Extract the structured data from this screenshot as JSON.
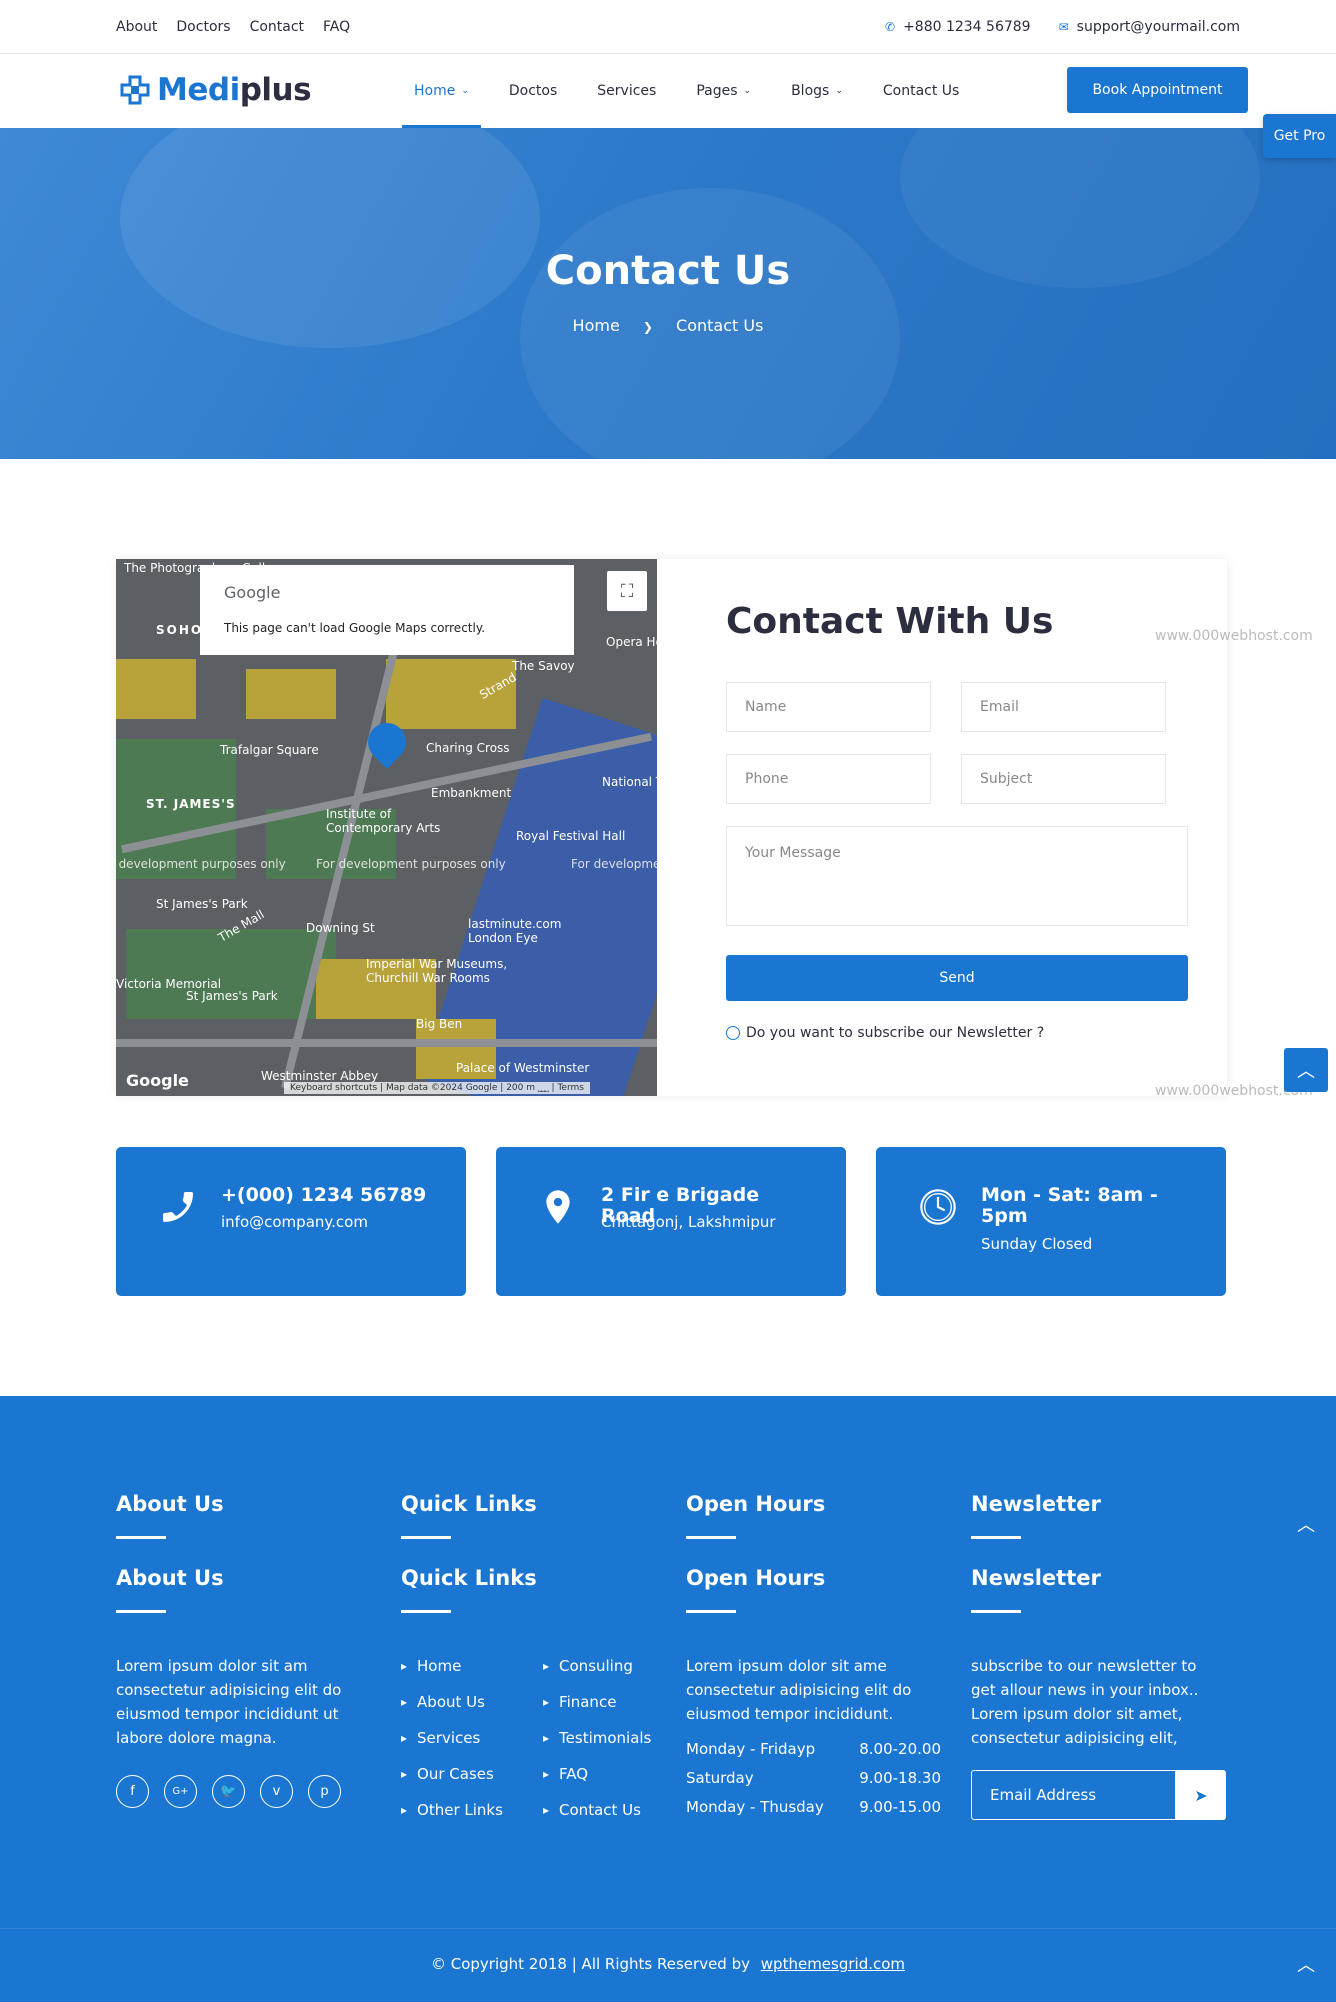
{
  "topbar": {
    "links": [
      "About",
      "Doctors",
      "Contact",
      "FAQ"
    ],
    "phone": "+880 1234 56789",
    "email": "support@yourmail.com"
  },
  "header": {
    "logo_blue": "Medi",
    "logo_dark": "plus",
    "nav": [
      {
        "label": "Home",
        "dropdown": true,
        "active": true
      },
      {
        "label": "Doctos",
        "dropdown": false
      },
      {
        "label": "Services",
        "dropdown": false
      },
      {
        "label": "Pages",
        "dropdown": true
      },
      {
        "label": "Blogs",
        "dropdown": true
      },
      {
        "label": "Contact Us",
        "dropdown": false
      }
    ],
    "book_button": "Book Appointment",
    "get_pro": "Get Pro"
  },
  "hero": {
    "title": "Contact Us",
    "crumb_home": "Home",
    "crumb_current": "Contact Us"
  },
  "map": {
    "provider": "Google",
    "error_message": "This page can't load Google Maps correctly.",
    "watermark": "For development purposes only",
    "labels": [
      "The Photographers Gallery",
      "SOHO",
      "Trafalgar Square",
      "Charing Cross",
      "ST. JAMES'S",
      "Institute of Contemporary Arts",
      "Embankment",
      "Royal Festival Hall",
      "St James's Park",
      "The Mall",
      "Downing St",
      "Imperial War Museums, Churchill War Rooms",
      "lastminute.com London Eye",
      "St James's Park",
      "Victoria Memorial",
      "Big Ben",
      "Westminster Abbey",
      "Palace of Westminster",
      "The Savoy",
      "Strand",
      "Opera House",
      "National Th"
    ],
    "attribution": [
      "Keyboard shortcuts",
      "Map data ©2024 Google",
      "200 m",
      "Terms"
    ]
  },
  "contact_form": {
    "title": "Contact With Us",
    "name_placeholder": "Name",
    "email_placeholder": "Email",
    "phone_placeholder": "Phone",
    "subject_placeholder": "Subject",
    "message_placeholder": "Your Message",
    "send_button": "Send",
    "newsletter_label": "Do you want to subscribe our Newsletter ?"
  },
  "broken_image_alt": "www.000webhost.com",
  "info_cards": [
    {
      "icon": "phone-icon",
      "title": "+(000) 1234 56789",
      "sub": "info@company.com"
    },
    {
      "icon": "map-pin-icon",
      "title": "2 Fir e Brigade Road",
      "sub": "Chittagonj, Lakshmipur"
    },
    {
      "icon": "clock-icon",
      "title": "Mon - Sat: 8am - 5pm",
      "sub": "Sunday Closed"
    }
  ],
  "footer": {
    "headings_row1": [
      "About Us",
      "Quick Links",
      "Open Hours",
      "Newsletter"
    ],
    "headings_row2": [
      "About Us",
      "Quick Links",
      "Open Hours",
      "Newsletter"
    ],
    "about_text": "Lorem ipsum dolor sit am consectetur adipisicing elit do eiusmod tempor incididunt ut labore dolore magna.",
    "social": [
      "f",
      "G+",
      "twitter",
      "v",
      "p"
    ],
    "quick_links_col1": [
      "Home",
      "About Us",
      "Services",
      "Our Cases",
      "Other Links"
    ],
    "quick_links_col2": [
      "Consuling",
      "Finance",
      "Testimonials",
      "FAQ",
      "Contact Us"
    ],
    "hours_text": "Lorem ipsum dolor sit ame consectetur adipisicing elit do eiusmod tempor incididunt.",
    "hours": [
      {
        "day": "Monday - Fridayp",
        "time": "8.00-20.00"
      },
      {
        "day": "Saturday",
        "time": "9.00-18.30"
      },
      {
        "day": "Monday - Thusday",
        "time": "9.00-15.00"
      }
    ],
    "newsletter_text": "subscribe to our newsletter to get allour news in your inbox.. Lorem ipsum dolor sit amet, consectetur adipisicing elit,",
    "email_placeholder": "Email Address"
  },
  "copyright": {
    "text": "© Copyright 2018 | All Rights Reserved by",
    "link": "wpthemesgrid.com"
  },
  "colors": {
    "primary": "#1a76d1",
    "text_dark": "#2c2d3f"
  }
}
